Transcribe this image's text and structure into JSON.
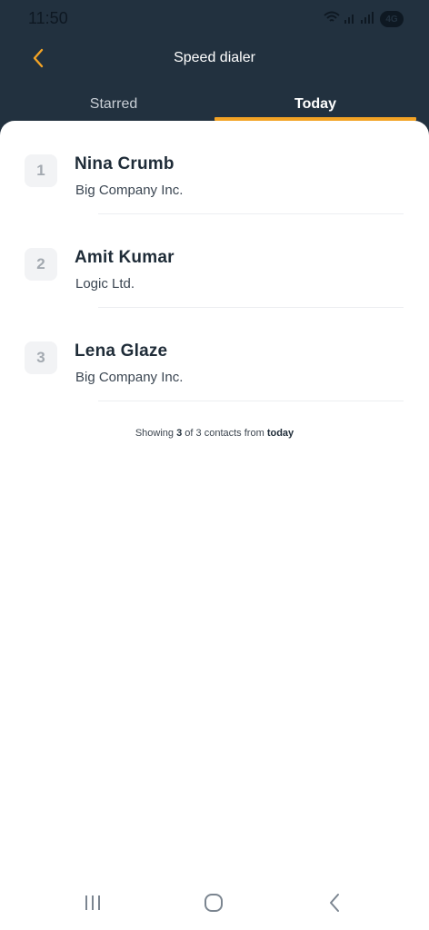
{
  "status_bar": {
    "time": "11:50",
    "network_badge": "4G"
  },
  "toolbar": {
    "title": "Speed dialer",
    "back_icon": "chevron-left-icon"
  },
  "tabs": [
    {
      "label": "Starred",
      "active": false
    },
    {
      "label": "Today",
      "active": true
    }
  ],
  "contacts": [
    {
      "rank": "1",
      "name": "Nina Crumb",
      "company": "Big Company Inc."
    },
    {
      "rank": "2",
      "name": "Amit Kumar",
      "company": "Logic Ltd."
    },
    {
      "rank": "3",
      "name": "Lena Glaze",
      "company": "Big Company Inc."
    }
  ],
  "footer": {
    "prefix": "Showing",
    "shown": "3",
    "of_word": "of",
    "total": "3",
    "middle": "contacts from",
    "period": "today"
  },
  "nav_bar": {
    "recents_icon": "recent-apps-icon",
    "home_icon": "home-icon",
    "back_icon": "back-icon"
  },
  "colors": {
    "header": "#22313f",
    "accent": "#f3a325"
  }
}
